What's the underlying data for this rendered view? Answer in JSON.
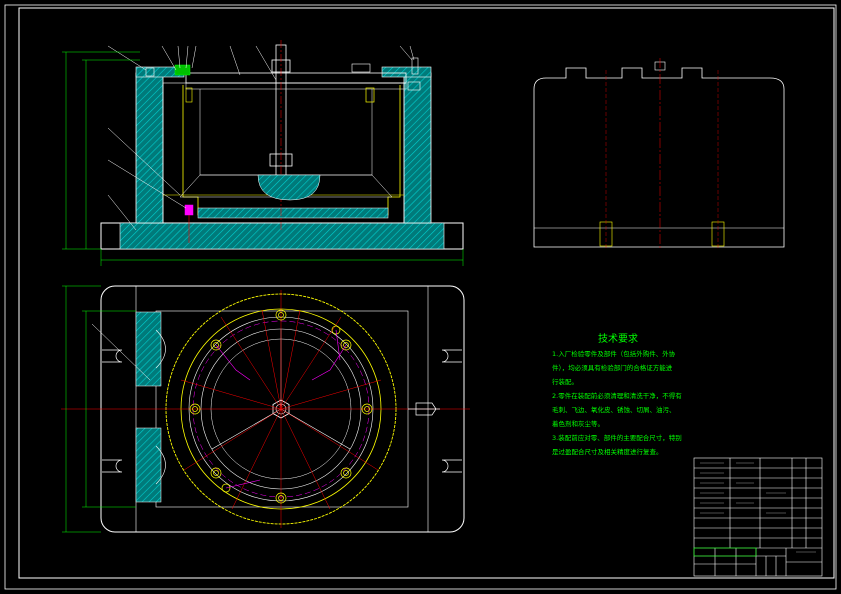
{
  "drawing": {
    "notes": {
      "title": "技术要求",
      "lines": [
        "1.入厂检验零件及部件（包括外购件、外协",
        "件），均必须具有检验部门的合格证方能进",
        "行装配。",
        "2.零件在装配前必须清理和清洗干净，不得有",
        "毛刺、飞边、氧化皮、锈蚀、切屑、油污、",
        "着色剂和灰尘等。",
        "3.装配前应对零、部件的主要配合尺寸，特别",
        "是过盈配合尺寸及相关精度进行复查。"
      ]
    },
    "colors": {
      "background": "#000000",
      "outline": "#ffffff",
      "section": "#00c8c8",
      "dimension": "#00ff00",
      "centerline": "#ff0000",
      "circle": "#ffff00",
      "magenta": "#ff00ff"
    }
  }
}
